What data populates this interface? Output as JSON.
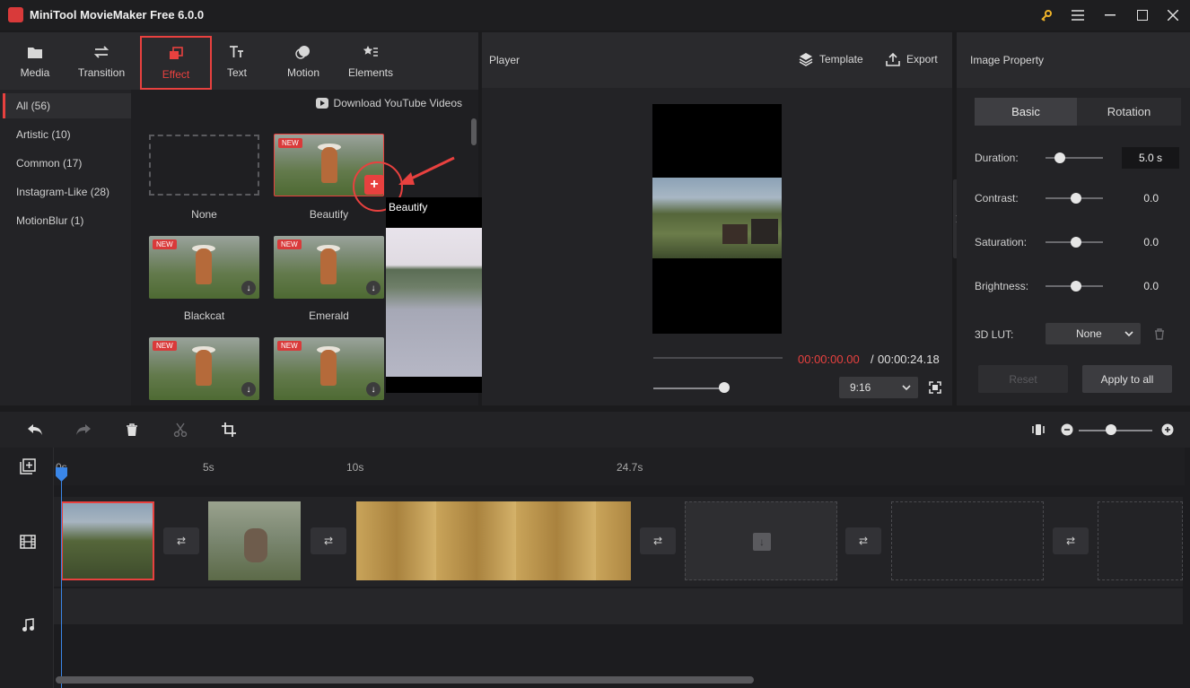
{
  "app": {
    "title": "MiniTool MovieMaker Free 6.0.0"
  },
  "toolbar": {
    "media": "Media",
    "transition": "Transition",
    "effect": "Effect",
    "text": "Text",
    "motion": "Motion",
    "elements": "Elements"
  },
  "categories": [
    "All (56)",
    "Artistic (10)",
    "Common (17)",
    "Instagram-Like (28)",
    "MotionBlur (1)"
  ],
  "download_youtube": "Download YouTube Videos",
  "effects": [
    {
      "label": "None"
    },
    {
      "label": "Beautify",
      "badge": "NEW"
    },
    {
      "label": "Blackcat",
      "badge": "NEW"
    },
    {
      "label": "Emerald",
      "badge": "NEW"
    },
    {
      "label": "",
      "badge": "NEW"
    },
    {
      "label": "",
      "badge": "NEW"
    }
  ],
  "preview_popup": {
    "title": "Beautify"
  },
  "player": {
    "title": "Player",
    "template": "Template",
    "export": "Export",
    "time_current": "00:00:00.00",
    "time_separator": "/",
    "time_total": "00:00:24.18",
    "aspect_ratio": "9:16"
  },
  "property": {
    "title": "Image Property",
    "tab_basic": "Basic",
    "tab_rotation": "Rotation",
    "duration_label": "Duration:",
    "duration_value": "5.0 s",
    "contrast_label": "Contrast:",
    "contrast_value": "0.0",
    "saturation_label": "Saturation:",
    "saturation_value": "0.0",
    "brightness_label": "Brightness:",
    "brightness_value": "0.0",
    "lut_label": "3D LUT:",
    "lut_value": "None",
    "reset": "Reset",
    "apply_all": "Apply to all"
  },
  "timeline": {
    "ticks": [
      "0s",
      "5s",
      "10s",
      "24.7s"
    ]
  },
  "colors": {
    "accent": "#e8413f",
    "playhead": "#3a86e8"
  }
}
